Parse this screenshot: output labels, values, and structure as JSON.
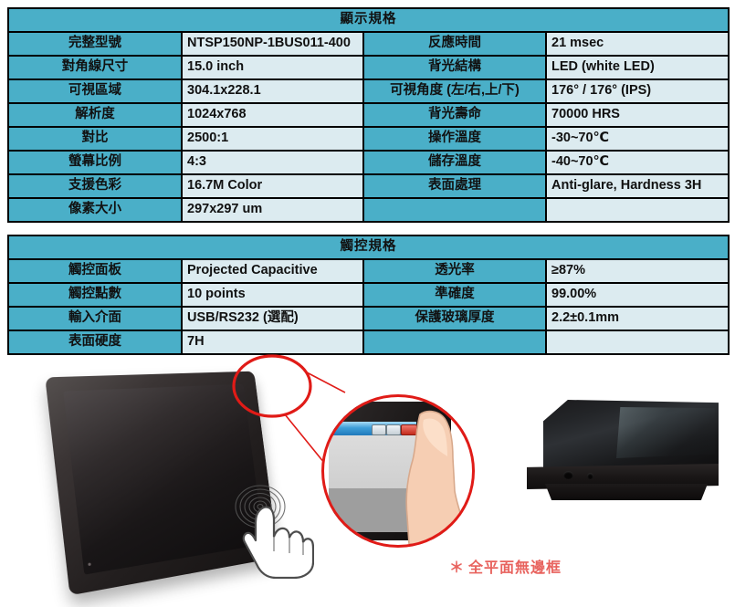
{
  "display_spec": {
    "title": "顯示規格",
    "rows": [
      {
        "label1": "完整型號",
        "value1": "NTSP150NP-1BUS011-400",
        "label2": "反應時間",
        "value2": "21 msec"
      },
      {
        "label1": "對角線尺寸",
        "value1": "15.0 inch",
        "label2": "背光結構",
        "value2": "LED (white LED)"
      },
      {
        "label1": "可視區域",
        "value1": "304.1x228.1",
        "label2": "可視角度 (左/右,上/下)",
        "value2": "176° / 176° (IPS)"
      },
      {
        "label1": "解析度",
        "value1": "1024x768",
        "label2": "背光壽命",
        "value2": "70000 HRS"
      },
      {
        "label1": "對比",
        "value1": "2500:1",
        "label2": "操作溫度",
        "value2": "-30~70℃"
      },
      {
        "label1": "螢幕比例",
        "value1": "4:3",
        "label2": "儲存溫度",
        "value2": "-40~70℃"
      },
      {
        "label1": "支援色彩",
        "value1": "16.7M Color",
        "label2": "表面處理",
        "value2": "Anti-glare, Hardness 3H"
      },
      {
        "label1": "像素大小",
        "value1": "297x297 um",
        "label2": "",
        "value2": ""
      }
    ]
  },
  "touch_spec": {
    "title": "觸控規格",
    "rows": [
      {
        "label1": "觸控面板",
        "value1": "Projected Capacitive",
        "label2": "透光率",
        "value2": "≥87%"
      },
      {
        "label1": "觸控點數",
        "value1": "10 points",
        "label2": "準確度",
        "value2": "99.00%"
      },
      {
        "label1": "輸入介面",
        "value1": "USB/RS232 (選配)",
        "label2": "保護玻璃厚度",
        "value2": "2.2±0.1mm"
      },
      {
        "label1": "表面硬度",
        "value1": "7H",
        "label2": "",
        "value2": ""
      }
    ]
  },
  "photos": {
    "main_monitor_name": "front-tilted-touch-monitor",
    "zoom_callout_name": "bezel-corner-magnified-detail",
    "side_monitor_name": "side-view-flat-bezel-monitor",
    "note_star": "＊",
    "note_text": "全平面無邊框"
  },
  "colors": {
    "header_teal": "#4aafc8",
    "value_ice": "#dcebf0",
    "border_black": "#000000",
    "note_red": "#e8635e",
    "callout_red": "#e01b17"
  }
}
